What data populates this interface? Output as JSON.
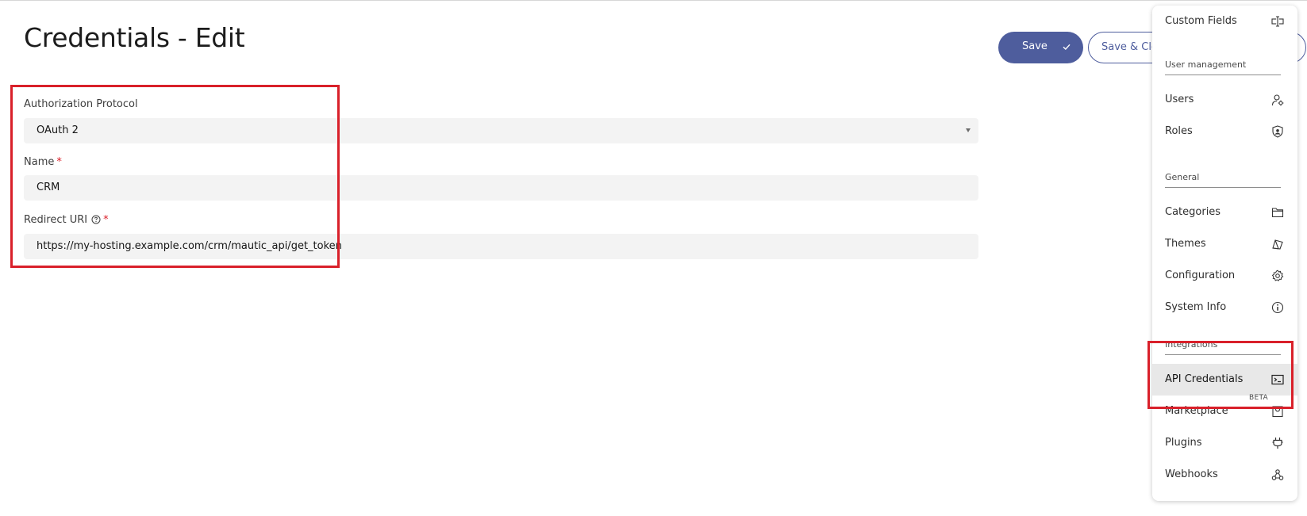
{
  "page": {
    "title": "Credentials - Edit"
  },
  "toolbar": {
    "save_label": "Save",
    "save_close_label": "Save & Clos"
  },
  "form": {
    "auth_protocol": {
      "label": "Authorization Protocol",
      "value": "OAuth 2"
    },
    "name": {
      "label": "Name",
      "required_mark": "*",
      "value": "CRM"
    },
    "redirect_uri": {
      "label": "Redirect URI",
      "required_mark": "*",
      "value": "https://my-hosting.example.com/crm/mautic_api/get_token"
    }
  },
  "menu": {
    "custom_fields": {
      "label": "Custom Fields",
      "icon": "custom-fields-icon"
    },
    "sections": {
      "user_management": "User management",
      "general": "General",
      "integrations": "Integrations"
    },
    "items": {
      "users": {
        "label": "Users",
        "icon": "user-settings-icon"
      },
      "roles": {
        "label": "Roles",
        "icon": "shield-user-icon"
      },
      "categories": {
        "label": "Categories",
        "icon": "folder-icon"
      },
      "themes": {
        "label": "Themes",
        "icon": "themes-icon"
      },
      "configuration": {
        "label": "Configuration",
        "icon": "gear-icon"
      },
      "system_info": {
        "label": "System Info",
        "icon": "info-icon"
      },
      "api_credentials": {
        "label": "API Credentials",
        "icon": "terminal-icon",
        "active": true
      },
      "marketplace": {
        "label": "Marketplace",
        "badge": "BETA",
        "icon": "shopping-bag-icon"
      },
      "plugins": {
        "label": "Plugins",
        "icon": "plug-icon"
      },
      "webhooks": {
        "label": "Webhooks",
        "icon": "webhook-icon"
      }
    }
  },
  "colors": {
    "accent": "#4e5d9d",
    "highlight": "#d9202a",
    "required": "#da1e28"
  }
}
